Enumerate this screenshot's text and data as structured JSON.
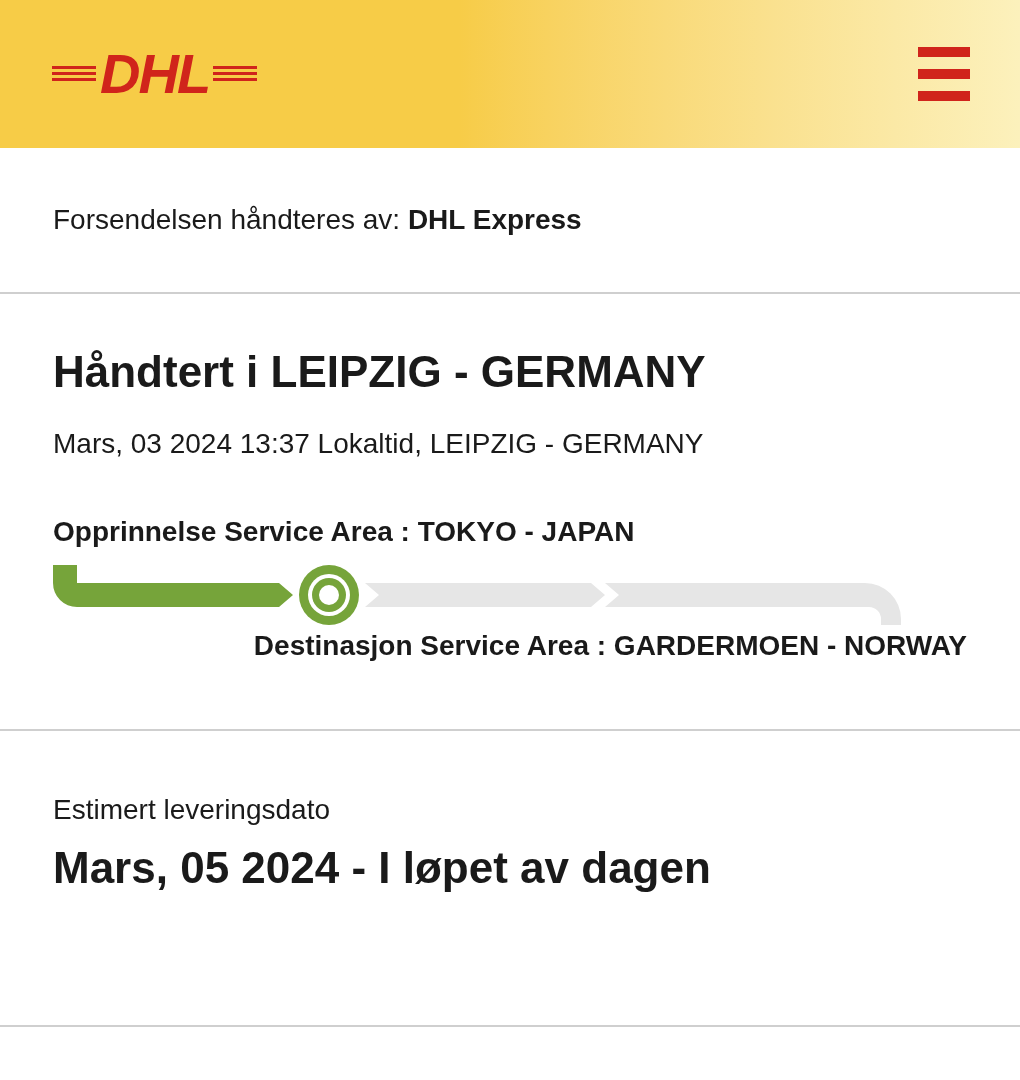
{
  "header": {
    "logo": "DHL"
  },
  "handler": {
    "label": "Forsendelsen håndteres av: ",
    "value": "DHL Express"
  },
  "status": {
    "title": "Håndtert i LEIPZIG - GERMANY",
    "time": "Mars, 03 2024 13:37 Lokaltid, LEIPZIG - GERMANY",
    "origin": "Opprinnelse Service Area : TOKYO - JAPAN",
    "stages": [
      {
        "done": true
      },
      {
        "done": false
      },
      {
        "done": false
      }
    ],
    "destination": "Destinasjon Service Area : GARDERMOEN - NORWAY"
  },
  "delivery": {
    "label": "Estimert leveringsdato",
    "date": "Mars, 05 2024 - I løpet av dagen"
  }
}
